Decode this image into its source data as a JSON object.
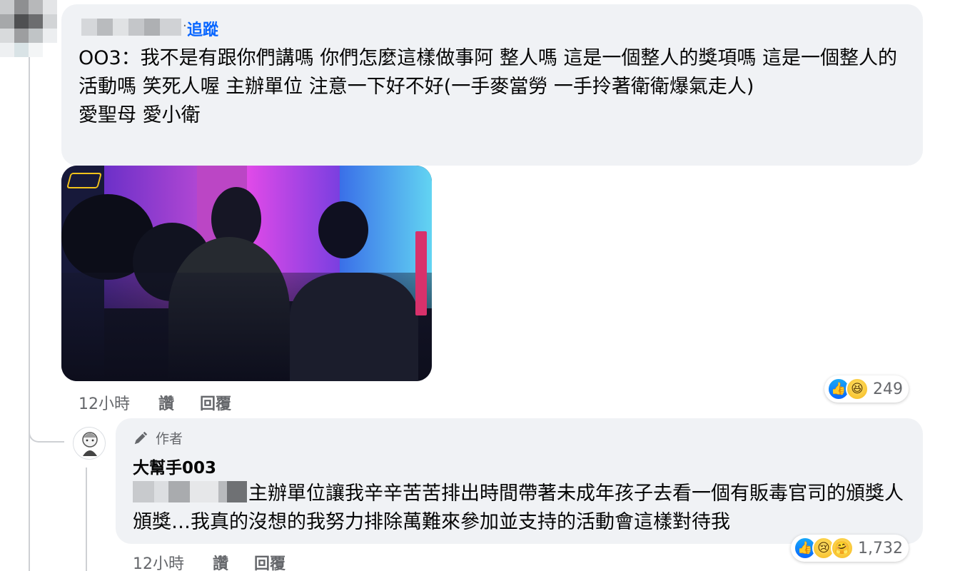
{
  "comment": {
    "follow_label": "追蹤",
    "text_line1": "OO3：我不是有跟你們講嗎 你們怎麼這樣做事阿 整人嗎 這是一個整人的獎項嗎 這是一個整人的活動嗎 笑死人喔 主辦單位 注意一下好不好(一手麥當勞 一手拎著衛衛爆氣走人)",
    "text_line2": "愛聖母 愛小衛",
    "timestamp": "12小時",
    "like_label": "讚",
    "reply_label": "回覆",
    "reaction_count": "249",
    "reactions": [
      "like-icon",
      "haha-icon"
    ]
  },
  "reply": {
    "author_badge": "作者",
    "author_name": "大幫手003",
    "text": "主辦單位讓我辛辛苦苦排出時間帶著未成年孩子去看一個有販毒官司的頒獎人頒獎…我真的沒想的我努力排除萬難來參加並支持的活動會這樣對待我",
    "timestamp": "12小時",
    "like_label": "讚",
    "reply_label": "回覆",
    "reaction_count": "1,732",
    "reactions": [
      "like-icon",
      "sad-icon",
      "care-icon"
    ]
  },
  "colors": {
    "bubble": "#f0f2f5",
    "link_blue": "#0866ff",
    "meta_gray": "#65676b",
    "text": "#050505"
  }
}
